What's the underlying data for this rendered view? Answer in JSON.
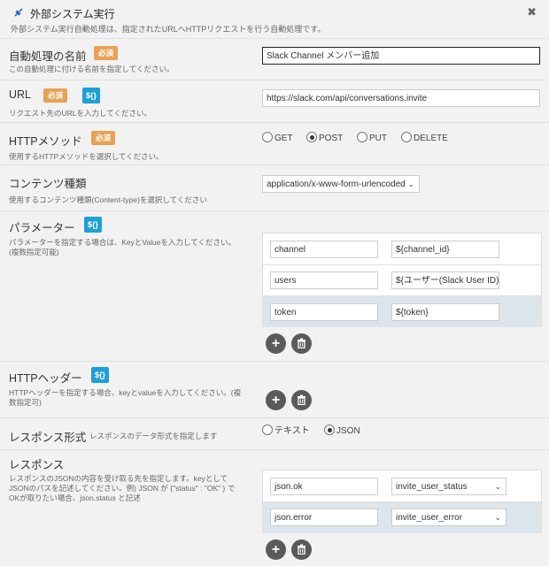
{
  "header": {
    "title": "外部システム実行",
    "subtitle": "外部システム実行自動処理は、指定されたURLへHTTPリクエストを行う自動処理です。"
  },
  "badges": {
    "required": "必須",
    "variable": "${}"
  },
  "name_row": {
    "label": "自動処理の名前",
    "desc": "この自動処理に付ける名前を指定してください。",
    "value": "Slack Channel メンバー追加"
  },
  "url_row": {
    "label": "URL",
    "desc": "リクエスト先のURLを入力してください。",
    "value": "https://slack.com/api/conversations.invite"
  },
  "method_row": {
    "label": "HTTPメソッド",
    "desc": "使用するHTTPメソッドを選択してください。",
    "options": [
      "GET",
      "POST",
      "PUT",
      "DELETE"
    ],
    "selected": "POST"
  },
  "content_row": {
    "label": "コンテンツ種類",
    "desc": "使用するコンテンツ種類(Content-type)を選択してください",
    "value": "application/x-www-form-urlencoded"
  },
  "params_row": {
    "label": "パラメーター",
    "desc1": "パラメーターを指定する場合は、KeyとValueを入力してください。",
    "desc2": "(複数指定可能)",
    "rows": [
      {
        "key": "channel",
        "value": "${channel_id}"
      },
      {
        "key": "users",
        "value": "${ユーザー(Slack User ID)"
      },
      {
        "key": "token",
        "value": "${token}"
      }
    ]
  },
  "headers_row": {
    "label": "HTTPヘッダー",
    "desc1": "HTTPヘッダーを指定する場合、keyとvalueを入力してください。(複",
    "desc2": "数指定可)"
  },
  "format_row": {
    "label": "レスポンス形式",
    "desc": "レスポンスのデータ形式を指定します",
    "options": [
      "テキスト",
      "JSON"
    ],
    "selected": "JSON"
  },
  "response_row": {
    "label": "レスポンス",
    "desc1": "レスポンスのJSONの内容を受け取る先を指定します。keyとして",
    "desc2": "JSONのパスを記述してください。例) JSON が {\"status\" : \"OK\" } で",
    "desc3": "OKが取りたい場合、json.status と記述",
    "rows": [
      {
        "key": "json.ok",
        "target": "invite_user_status"
      },
      {
        "key": "json.error",
        "target": "invite_user_error"
      }
    ]
  },
  "icons": {
    "add": "plus-icon",
    "delete": "trash-icon",
    "close": "close-icon",
    "plug": "plug-icon"
  }
}
